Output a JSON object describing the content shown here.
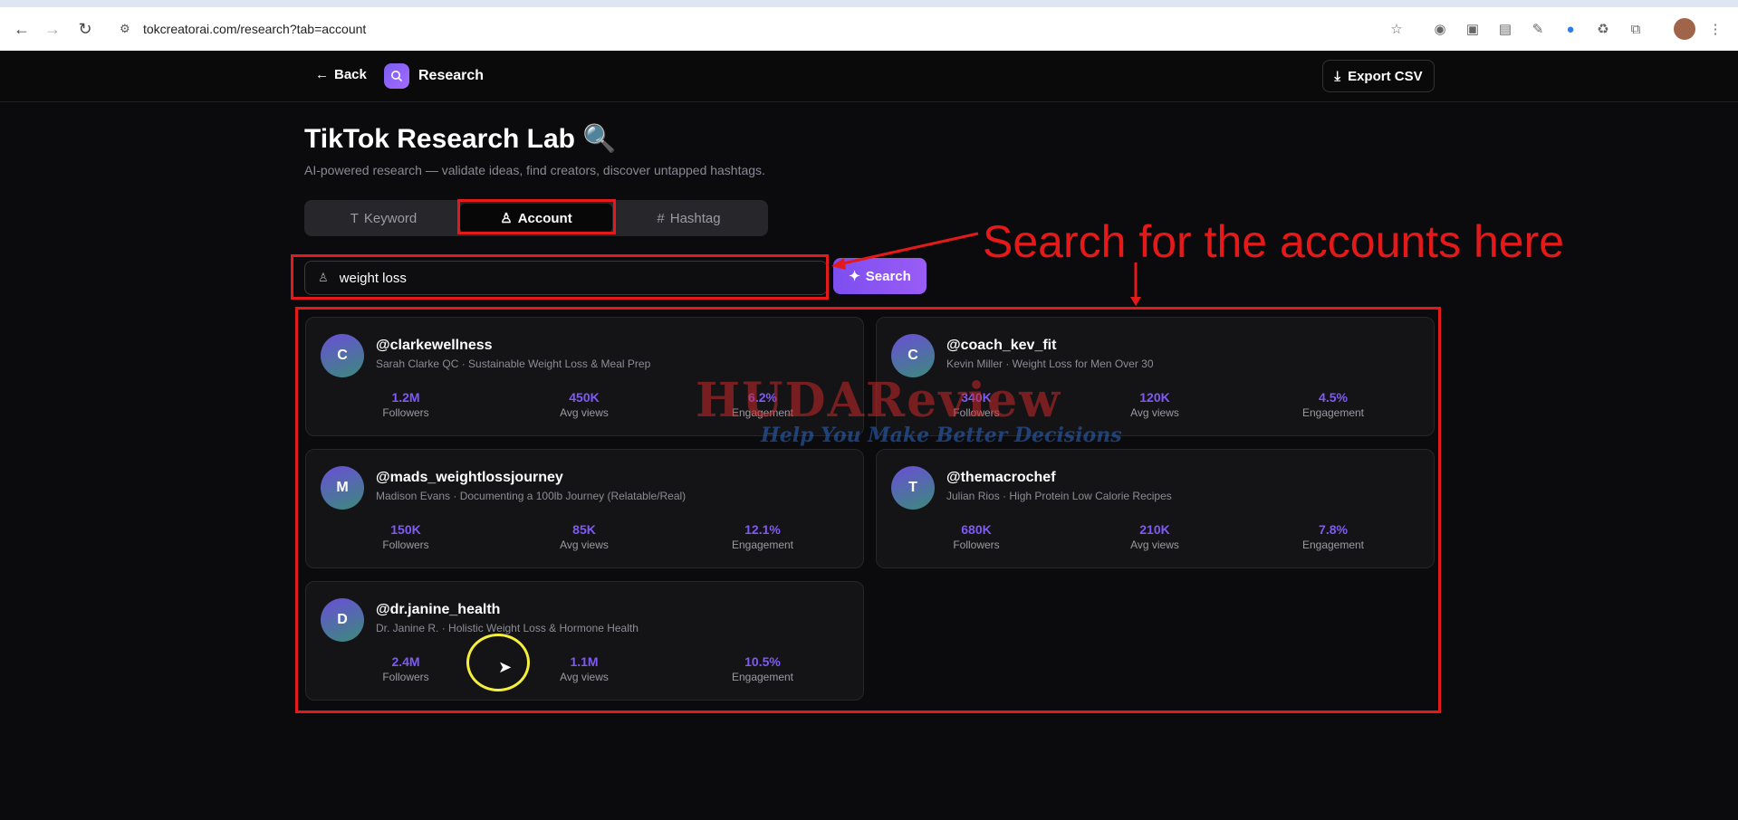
{
  "browser": {
    "url": "tokcreatorai.com/research?tab=account"
  },
  "header": {
    "back_label": "Back",
    "brand": "Research",
    "export_label": "Export CSV"
  },
  "page": {
    "title": "TikTok Research Lab 🔍",
    "subtitle": "AI-powered research — validate ideas, find creators, discover untapped hashtags."
  },
  "tabs": [
    {
      "label": "Keyword",
      "icon": "text-icon",
      "active": false
    },
    {
      "label": "Account",
      "icon": "user-icon",
      "active": true
    },
    {
      "label": "Hashtag",
      "icon": "hash-icon",
      "active": false
    }
  ],
  "search": {
    "value": "weight loss",
    "button_label": "Search"
  },
  "stat_labels": {
    "followers": "Followers",
    "avg_views": "Avg views",
    "engagement": "Engagement"
  },
  "accounts": [
    {
      "initial": "C",
      "handle": "@clarkewellness",
      "desc": "Sarah Clarke QC · Sustainable Weight Loss & Meal Prep",
      "followers": "1.2M",
      "avg_views": "450K",
      "engagement": "6.2%"
    },
    {
      "initial": "C",
      "handle": "@coach_kev_fit",
      "desc": "Kevin Miller · Weight Loss for Men Over 30",
      "followers": "340K",
      "avg_views": "120K",
      "engagement": "4.5%"
    },
    {
      "initial": "M",
      "handle": "@mads_weightlossjourney",
      "desc": "Madison Evans · Documenting a 100lb Journey (Relatable/Real)",
      "followers": "150K",
      "avg_views": "85K",
      "engagement": "12.1%"
    },
    {
      "initial": "T",
      "handle": "@themacrochef",
      "desc": "Julian Rios · High Protein Low Calorie Recipes",
      "followers": "680K",
      "avg_views": "210K",
      "engagement": "7.8%"
    },
    {
      "initial": "D",
      "handle": "@dr.janine_health",
      "desc": "Dr. Janine R. · Holistic Weight Loss & Hormone Health",
      "followers": "2.4M",
      "avg_views": "1.1M",
      "engagement": "10.5%"
    }
  ],
  "annotation": {
    "text": "Search for the accounts here",
    "color": "#e41a1a"
  },
  "watermark": {
    "line1": "HUDAReview",
    "line2": "Help You Make Better Decisions"
  },
  "colors": {
    "accent": "#7f5af5",
    "background": "#0b0b0d"
  }
}
